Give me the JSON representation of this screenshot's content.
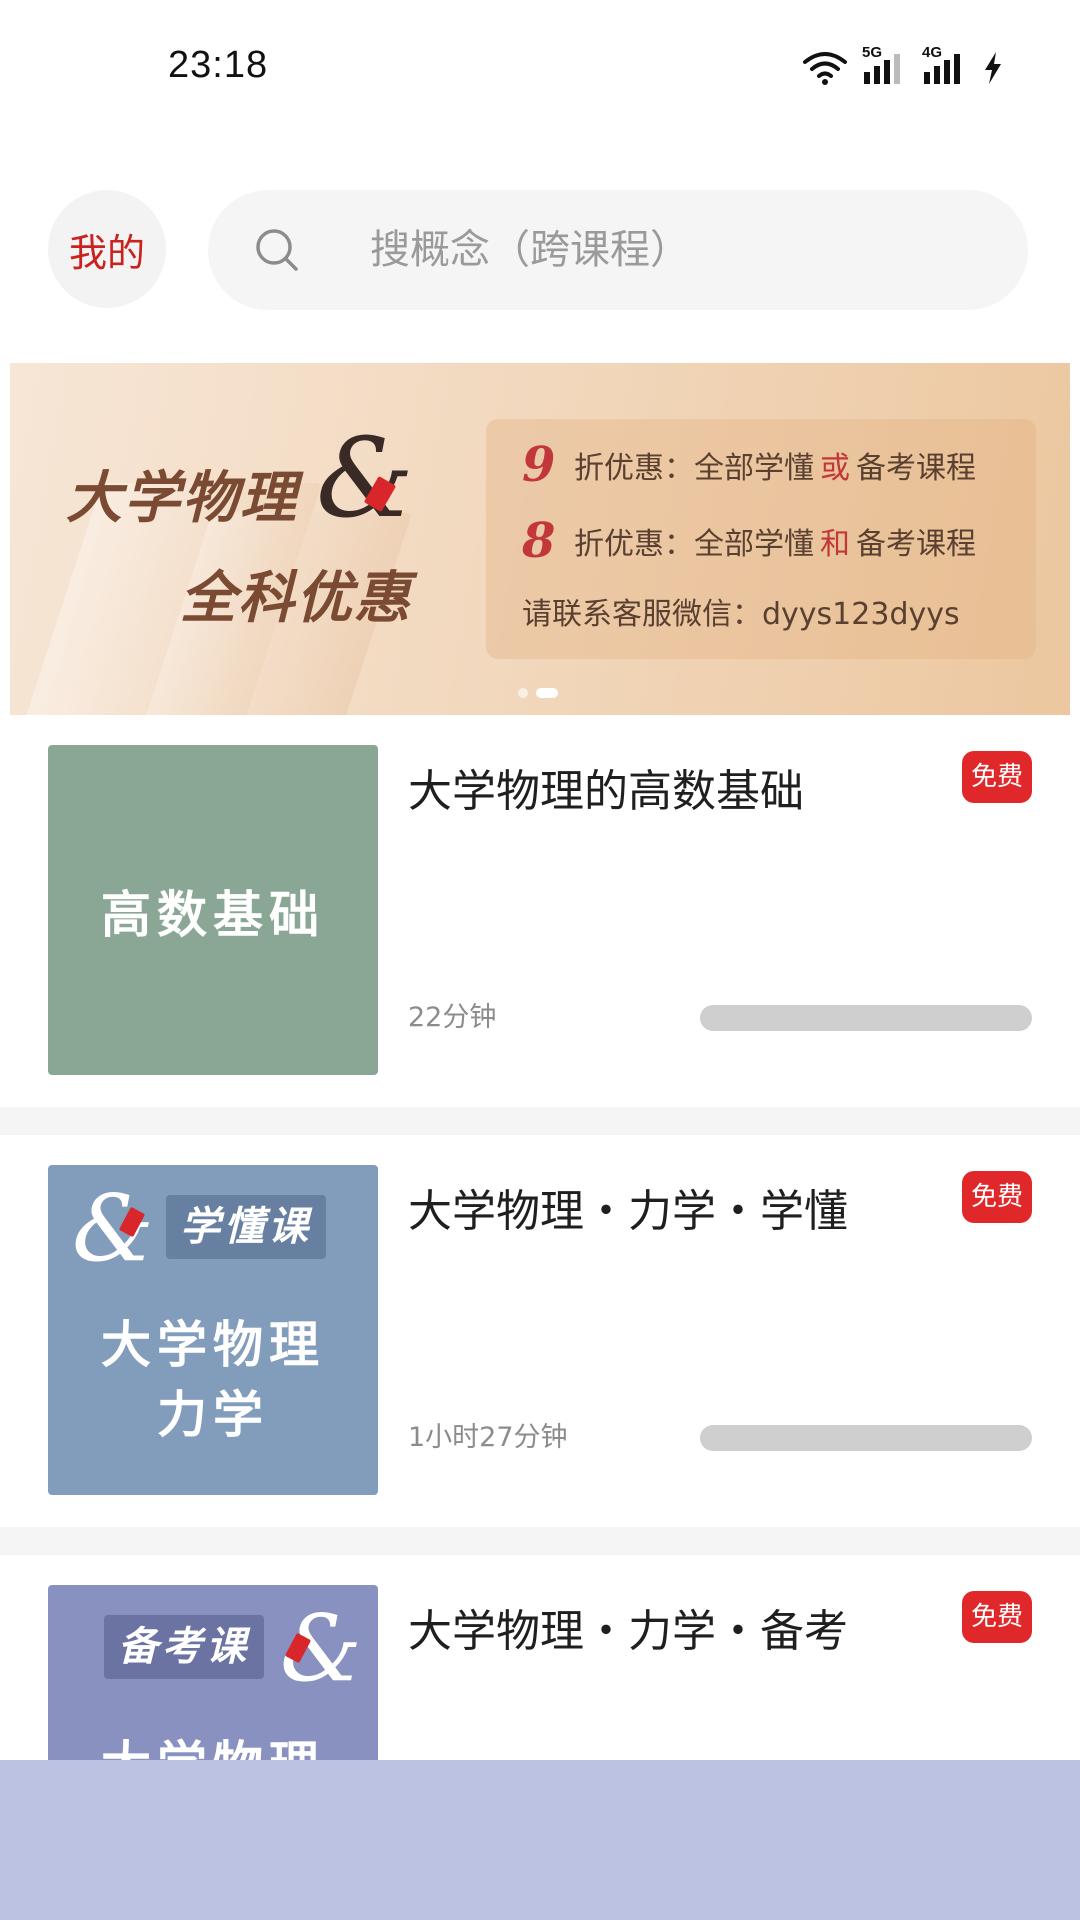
{
  "status_bar": {
    "time": "23:18",
    "signal1_label": "5G",
    "signal2_label": "4G"
  },
  "header": {
    "me_label": "我的",
    "search_placeholder": "搜概念（跨课程）"
  },
  "banner": {
    "title_line1": "大学物理",
    "amp": "&",
    "title_line2": "全科优惠",
    "promos": [
      {
        "number": "9",
        "prefix": "折优惠：全部学懂",
        "highlight": "或",
        "suffix": "备考课程"
      },
      {
        "number": "8",
        "prefix": "折优惠：全部学懂",
        "highlight": "和",
        "suffix": "备考课程"
      }
    ],
    "contact": "请联系客服微信：dyys123dyys",
    "pages": 2,
    "active_page": 2
  },
  "courses": [
    {
      "title": "大学物理的高数基础",
      "badge": "免费",
      "duration": "22分钟",
      "progress": 0,
      "cover": {
        "color": "#8aa796",
        "text": "高数基础"
      }
    },
    {
      "title": "大学物理・力学・学懂",
      "badge": "免费",
      "duration": "1小时27分钟",
      "progress": 0,
      "cover": {
        "color": "#829cbb",
        "tag": "学懂课",
        "tag_color": "#6780a1",
        "line1": "大学物理",
        "line2": "力学",
        "amp": "&"
      }
    },
    {
      "title": "大学物理・力学・备考",
      "badge": "免费",
      "cover": {
        "color": "#8891bf",
        "tag": "备考课",
        "tag_color": "#6b73a3",
        "line1": "大学物理",
        "amp": "&"
      }
    }
  ],
  "colors": {
    "accent": "#e0282b",
    "me_text": "#c8231f",
    "overlay": "#bcc3e2"
  }
}
